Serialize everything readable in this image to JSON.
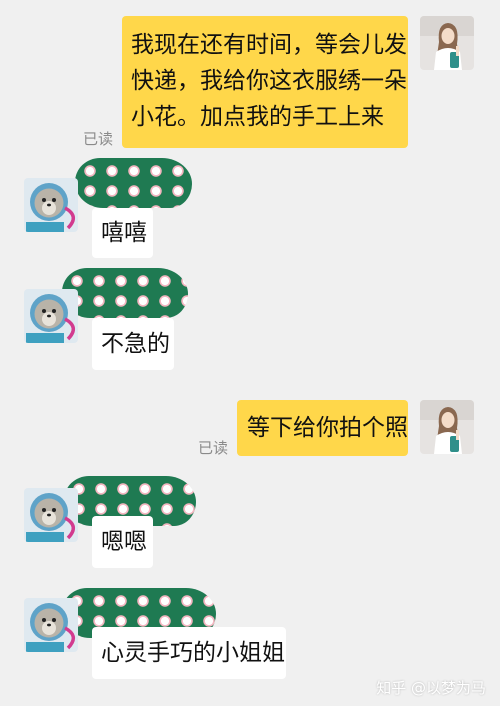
{
  "messages": {
    "m1": {
      "text_line1": "我现在还有时间，等会儿发",
      "text_line2": "快递，我给你这衣服绣一朵",
      "text_line3": "小花。加点我的手工上来",
      "status": "已读"
    },
    "m2": {
      "text": "嘻嘻"
    },
    "m3": {
      "text": "不急的"
    },
    "m4": {
      "text": "等下给你拍个照",
      "status": "已读"
    },
    "m5": {
      "text": "嗯嗯"
    },
    "m6": {
      "text": "心灵手巧的小姐姐"
    }
  },
  "watermark": "知乎 @以梦为马",
  "colors": {
    "background": "#f0f0f0",
    "sent_bubble": "#ffd74a",
    "received_bubble": "#ffffff",
    "sticker_green": "#1f7a52"
  },
  "icons": {
    "self_avatar": "girl-photo-avatar",
    "peer_avatar": "seal-cartoon-avatar"
  }
}
